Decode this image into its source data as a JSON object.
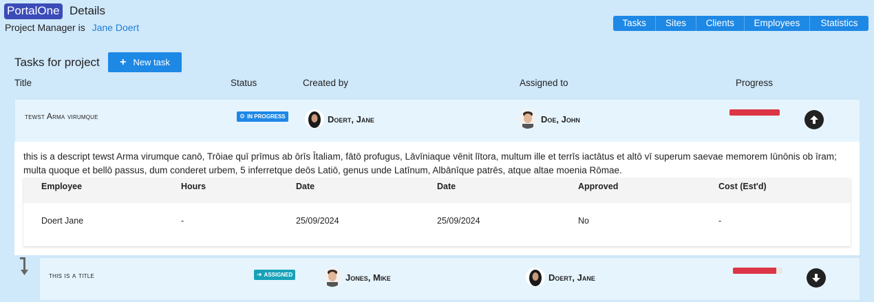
{
  "app": {
    "brand": "PortalOne",
    "page_title": "Details"
  },
  "project": {
    "manager_prefix": "Project Manager is",
    "manager_name": "Jane Doert"
  },
  "nav": [
    "Tasks",
    "Sites",
    "Clients",
    "Employees",
    "Statistics"
  ],
  "tasks_section": {
    "title": "Tasks for project",
    "new_task_label": "New task"
  },
  "columns": {
    "title": "Title",
    "status": "Status",
    "created_by": "Created by",
    "assigned_to": "Assigned to",
    "progress": "Progress"
  },
  "tasks": [
    {
      "title": "tewst Arma virumque",
      "status": "IN PROGRESS",
      "status_color": "#1e88e5",
      "status_icon": "cogs-icon",
      "created_by": "Doert, Jane",
      "assigned_to": "Doe, John",
      "progress": 1.0,
      "action_icon": "arrow-up-circle-icon",
      "description": "this is a descript tewst Arma virumque canō, Trōiae quī prīmus ab ōrīs Ītaliam, fātō profugus, Lāvīniaque vēnit lītora, multum ille et terrīs iactātus et altō vī superum saevae memorem Iūnōnis ob īram; multa quoque et bellō passus, dum conderet urbem, 5 inferretque deōs Latiō, genus unde Latīnum, Albānīque patrēs, atque altae moenia Rōmae.",
      "log_headers": [
        "Employee",
        "Hours",
        "Date",
        "Date",
        "Approved",
        "Cost (Est'd)"
      ],
      "log_rows": [
        [
          "Doert Jane",
          "-",
          "25/09/2024",
          "25/09/2024",
          "No",
          "-"
        ]
      ]
    },
    {
      "title": "this is a title",
      "status": "ASSIGNED",
      "status_color": "#17a2b8",
      "status_icon": "arrow-right-circle-icon",
      "created_by": "Jones, Mike",
      "assigned_to": "Doert, Jane",
      "progress": 0.87,
      "action_icon": "arrow-down-circle-icon"
    }
  ],
  "colors": {
    "background": "#cfe8fa",
    "primary": "#1e88e5",
    "brand": "#3b4cb8",
    "progress": "#dc3545"
  }
}
